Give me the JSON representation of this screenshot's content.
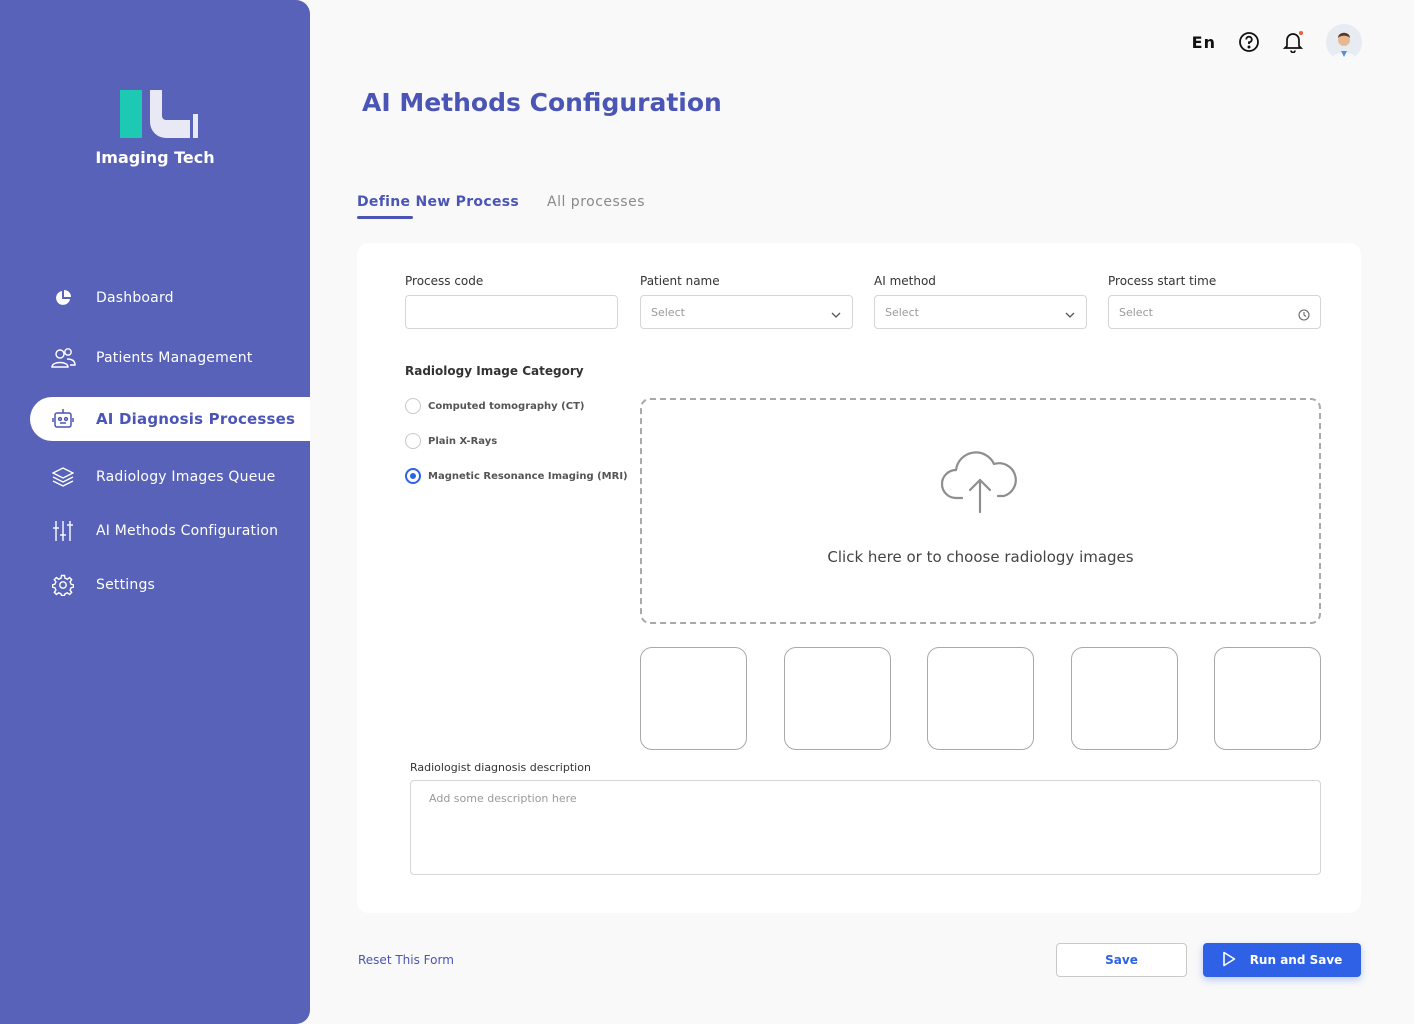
{
  "brand": {
    "name": "Imaging Tech",
    "primary_color": "#5862b8",
    "accent_color": "#1ec9b4"
  },
  "sidebar": {
    "items": [
      {
        "label": "Dashboard",
        "icon": "pie-chart-icon",
        "active": false
      },
      {
        "label": "Patients Management",
        "icon": "users-icon",
        "active": false
      },
      {
        "label": "AI Diagnosis Processes",
        "icon": "robot-icon",
        "active": true
      },
      {
        "label": "Radiology Images Queue",
        "icon": "layers-icon",
        "active": false
      },
      {
        "label": "AI Methods Configuration",
        "icon": "sliders-icon",
        "active": false
      },
      {
        "label": "Settings",
        "icon": "gear-icon",
        "active": false
      }
    ]
  },
  "topbar": {
    "language": "En"
  },
  "page": {
    "title": "AI Methods Configuration"
  },
  "tabs": [
    {
      "label": "Define New Process",
      "active": true
    },
    {
      "label": "All processes",
      "active": false
    }
  ],
  "form": {
    "process_code": {
      "label": "Process code",
      "value": ""
    },
    "patient_name": {
      "label": "Patient name",
      "placeholder": "Select"
    },
    "ai_method": {
      "label": "AI method",
      "placeholder": "Select"
    },
    "start_time": {
      "label": "Process start time",
      "placeholder": "Select"
    },
    "category": {
      "title": "Radiology Image Category",
      "options": [
        {
          "label": "Computed tomography (CT)",
          "selected": false
        },
        {
          "label": "Plain X-Rays",
          "selected": false
        },
        {
          "label": "Magnetic Resonance Imaging (MRI)",
          "selected": true
        }
      ]
    },
    "upload": {
      "text": "Click here or to choose radiology images"
    },
    "description": {
      "label": "Radiologist diagnosis description",
      "placeholder": "Add some description here"
    }
  },
  "footer": {
    "reset_label": "Reset This Form",
    "save_label": "Save",
    "run_label": "Run and Save"
  }
}
